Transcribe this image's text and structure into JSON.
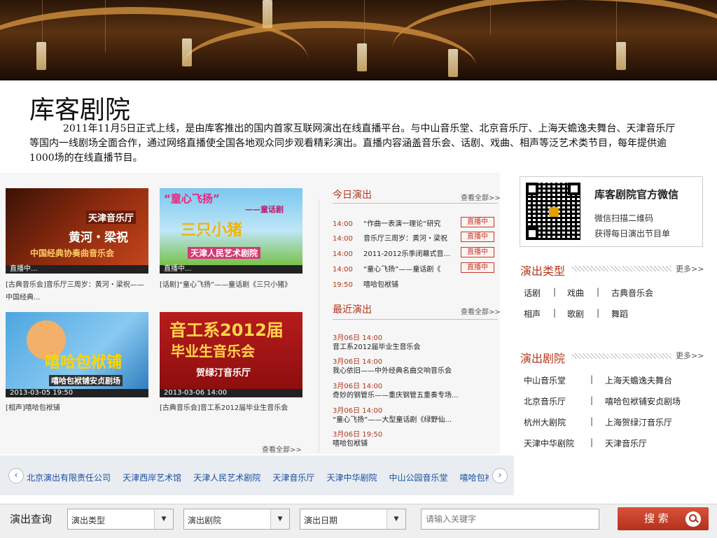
{
  "page": {
    "title": "库客剧院",
    "intro": "2011年11月5日正式上线，是由库客推出的国内首家互联网演出在线直播平台。与中山音乐堂、北京音乐厅、上海天蟾逸夫舞台、天津音乐厅等国内一线剧场全面合作，通过网络直播使全国各地观众同步观看精彩演出。直播内容涵盖音乐会、话剧、戏曲、相声等泛艺术类节目，每年提供逾1000场的在线直播节目。"
  },
  "featured": [
    {
      "status": "直播中...",
      "art_lines": [
        "天津音乐厅",
        "黄河・梁祝",
        "中国经典协奏曲音乐会"
      ],
      "caption": "[古典音乐会]音乐厅三周岁：黄河・梁祝——中国经典..."
    },
    {
      "status": "直播中...",
      "art_lines": [
        "“童心飞扬”",
        "——童话剧",
        "三只小猪",
        "天津人民艺术剧院"
      ],
      "caption": "[话剧]“童心飞扬”——童话剧《三只小猪》"
    },
    {
      "status": "2013-03-05 19:50",
      "art_lines": [
        "嘻哈包袱铺",
        "嘻哈包袱铺安贞剧场"
      ],
      "caption": "[相声]嘻哈包袱铺"
    },
    {
      "status": "2013-03-06 14:00",
      "art_lines": [
        "音工系2012届",
        "毕业生音乐会",
        "贺绿汀音乐厅"
      ],
      "caption": "[古典音乐会]音工系2012届毕业生音乐会"
    }
  ],
  "today": {
    "title": "今日演出",
    "more": "查看全部>>",
    "live_label": "直播中",
    "items": [
      {
        "time": "14:00",
        "name": "“作曲一表演一理论”研究",
        "live": true
      },
      {
        "time": "14:00",
        "name": "音乐厅三周岁：黄河・梁祝",
        "live": true
      },
      {
        "time": "14:00",
        "name": "2011-2012乐季闭幕式音...",
        "live": true
      },
      {
        "time": "14:00",
        "name": "“童心飞扬”——童话剧《",
        "live": true
      },
      {
        "time": "19:50",
        "name": "嘻哈包袱铺",
        "live": false
      }
    ]
  },
  "recent": {
    "title": "最近演出",
    "more": "查看全部>>",
    "items": [
      {
        "date": "3月06日 14:00",
        "name": "音工系2012届毕业生音乐会"
      },
      {
        "date": "3月06日 14:00",
        "name": "我心依旧——中外经典名曲交响音乐会"
      },
      {
        "date": "3月06日 14:00",
        "name": "奇妙的钢管乐——重庆钢管五重奏专场..."
      },
      {
        "date": "3月06日 14:00",
        "name": "“童心飞扬”——大型童话剧《绿野仙..."
      },
      {
        "date": "3月06日 19:50",
        "name": "嘻哈包袱铺"
      }
    ]
  },
  "bottom_more": "查看全部>>",
  "wechat": {
    "title": "库客剧院官方微信",
    "line1": "微信扫描二维码",
    "line2": "获得每日演出节目单"
  },
  "types": {
    "title": "演出类型",
    "more": "更多>>",
    "row1": [
      "话剧",
      "戏曲",
      "古典音乐会"
    ],
    "row2": [
      "相声",
      "歌剧",
      "舞蹈"
    ]
  },
  "theaters": {
    "title": "演出剧院",
    "more": "更多>>",
    "rows": [
      [
        "中山音乐堂",
        "上海天蟾逸夫舞台"
      ],
      [
        "北京音乐厅",
        "嘻哈包袱铺安贞剧场"
      ],
      [
        "杭州大剧院",
        "上海贺绿汀音乐厅"
      ],
      [
        "天津中华剧院",
        "天津音乐厅"
      ]
    ]
  },
  "scroller": {
    "prev_icon": "chevron-left-icon",
    "next_icon": "chevron-right-icon",
    "links": [
      "北京演出有限责任公司",
      "天津西岸艺术馆",
      "天津人民艺术剧院",
      "天津音乐厅",
      "天津中华剧院",
      "中山公园音乐堂",
      "嘻哈包袱铺"
    ]
  },
  "search": {
    "label": "演出查询",
    "type_value": "演出类型",
    "theater_value": "演出剧院",
    "date_value": "演出日期",
    "keyword_placeholder": "请输入关键字",
    "button": "搜 索",
    "button_icon": "search-icon"
  },
  "colors": {
    "accent": "#b2361c",
    "link": "#1a4fa0"
  }
}
